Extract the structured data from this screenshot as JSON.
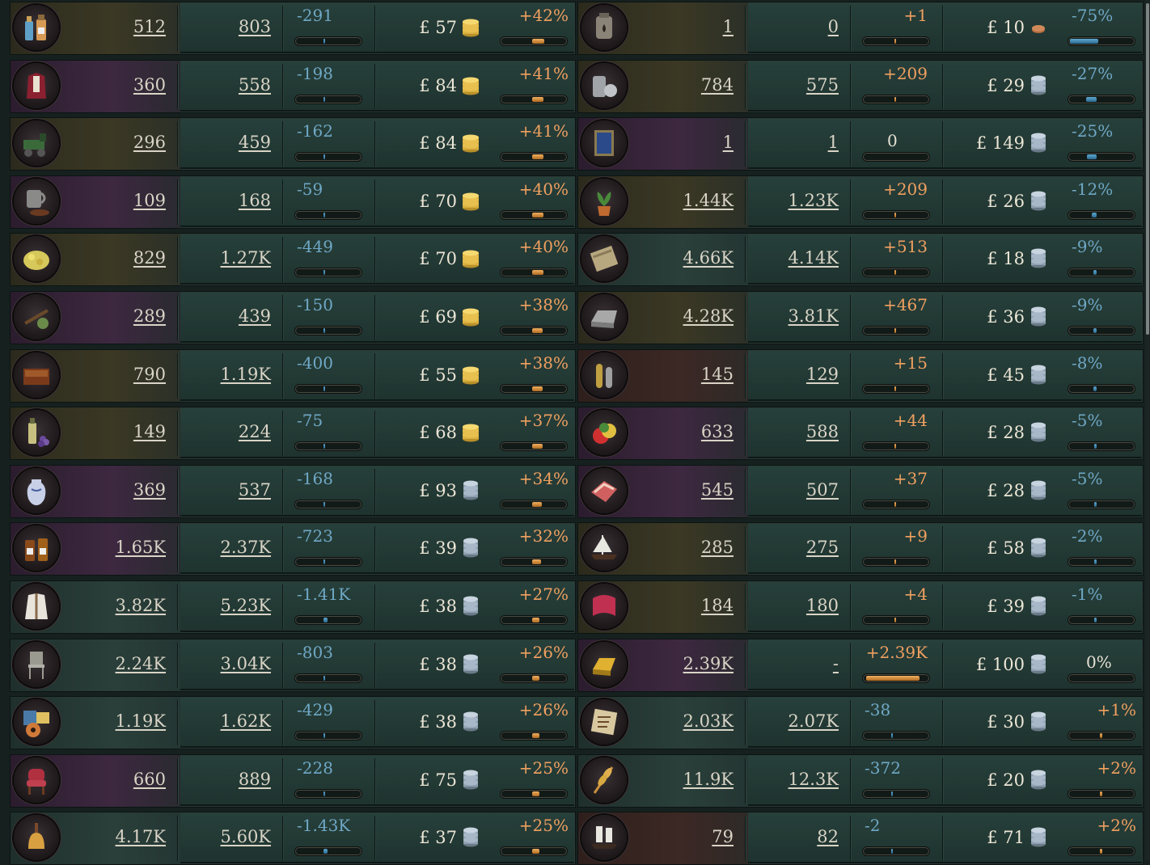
{
  "rows_left": [
    {
      "icon": "medicine-bottles-icon",
      "theme": "olive",
      "supply": "512",
      "demand": "803",
      "delta": "-291",
      "delta_sign": "neg",
      "delta_fill": 0.0,
      "price": "£ 57",
      "coin": "gold",
      "pct": "+42%",
      "pct_sign": "pos",
      "pct_fill": 0.42
    },
    {
      "icon": "luxury-clothes-icon",
      "theme": "purple",
      "supply": "360",
      "demand": "558",
      "delta": "-198",
      "delta_sign": "neg",
      "delta_fill": 0.0,
      "price": "£ 84",
      "coin": "gold",
      "pct": "+41%",
      "pct_sign": "pos",
      "pct_fill": 0.41
    },
    {
      "icon": "engine-icon",
      "theme": "olive",
      "supply": "296",
      "demand": "459",
      "delta": "-162",
      "delta_sign": "neg",
      "delta_fill": 0.0,
      "price": "£ 84",
      "coin": "gold",
      "pct": "+41%",
      "pct_sign": "pos",
      "pct_fill": 0.41
    },
    {
      "icon": "coffee-icon",
      "theme": "purple",
      "supply": "109",
      "demand": "168",
      "delta": "-59",
      "delta_sign": "neg",
      "delta_fill": 0.0,
      "price": "£ 70",
      "coin": "gold",
      "pct": "+40%",
      "pct_sign": "pos",
      "pct_fill": 0.4
    },
    {
      "icon": "gold-nuggets-icon",
      "theme": "olive",
      "supply": "829",
      "demand": "1.27K",
      "delta": "-449",
      "delta_sign": "neg",
      "delta_fill": 0.0,
      "price": "£ 70",
      "coin": "gold",
      "pct": "+40%",
      "pct_sign": "pos",
      "pct_fill": 0.4
    },
    {
      "icon": "opium-icon",
      "theme": "purple",
      "supply": "289",
      "demand": "439",
      "delta": "-150",
      "delta_sign": "neg",
      "delta_fill": 0.0,
      "price": "£ 69",
      "coin": "gold",
      "pct": "+38%",
      "pct_sign": "pos",
      "pct_fill": 0.38
    },
    {
      "icon": "tobacco-icon",
      "theme": "olive",
      "supply": "790",
      "demand": "1.19K",
      "delta": "-400",
      "delta_sign": "neg",
      "delta_fill": 0.0,
      "price": "£ 55",
      "coin": "gold",
      "pct": "+38%",
      "pct_sign": "pos",
      "pct_fill": 0.38
    },
    {
      "icon": "wine-icon",
      "theme": "olive",
      "supply": "149",
      "demand": "224",
      "delta": "-75",
      "delta_sign": "neg",
      "delta_fill": 0.0,
      "price": "£ 68",
      "coin": "gold",
      "pct": "+37%",
      "pct_sign": "pos",
      "pct_fill": 0.37
    },
    {
      "icon": "porcelain-icon",
      "theme": "purple",
      "supply": "369",
      "demand": "537",
      "delta": "-168",
      "delta_sign": "neg",
      "delta_fill": 0.0,
      "price": "£ 93",
      "coin": "silver",
      "pct": "+34%",
      "pct_sign": "pos",
      "pct_fill": 0.34
    },
    {
      "icon": "liquor-icon",
      "theme": "purple",
      "supply": "1.65K",
      "demand": "2.37K",
      "delta": "-723",
      "delta_sign": "neg",
      "delta_fill": 0.0,
      "price": "£ 39",
      "coin": "silver",
      "pct": "+32%",
      "pct_sign": "pos",
      "pct_fill": 0.32
    },
    {
      "icon": "clothes-icon",
      "theme": "teal",
      "supply": "3.82K",
      "demand": "5.23K",
      "delta": "-1.41K",
      "delta_sign": "neg",
      "delta_fill": 0.06,
      "price": "£ 38",
      "coin": "silver",
      "pct": "+27%",
      "pct_sign": "pos",
      "pct_fill": 0.27
    },
    {
      "icon": "furniture-icon",
      "theme": "teal",
      "supply": "2.24K",
      "demand": "3.04K",
      "delta": "-803",
      "delta_sign": "neg",
      "delta_fill": 0.03,
      "price": "£ 38",
      "coin": "silver",
      "pct": "+26%",
      "pct_sign": "pos",
      "pct_fill": 0.26
    },
    {
      "icon": "groceries-icon",
      "theme": "teal",
      "supply": "1.19K",
      "demand": "1.62K",
      "delta": "-429",
      "delta_sign": "neg",
      "delta_fill": 0.0,
      "price": "£ 38",
      "coin": "silver",
      "pct": "+26%",
      "pct_sign": "pos",
      "pct_fill": 0.26
    },
    {
      "icon": "luxury-furniture-icon",
      "theme": "purple",
      "supply": "660",
      "demand": "889",
      "delta": "-228",
      "delta_sign": "neg",
      "delta_fill": 0.0,
      "price": "£ 75",
      "coin": "silver",
      "pct": "+25%",
      "pct_sign": "pos",
      "pct_fill": 0.25
    },
    {
      "icon": "services-bell-icon",
      "theme": "teal",
      "supply": "4.17K",
      "demand": "5.60K",
      "delta": "-1.43K",
      "delta_sign": "neg",
      "delta_fill": 0.06,
      "price": "£ 37",
      "coin": "silver",
      "pct": "+25%",
      "pct_sign": "pos",
      "pct_fill": 0.25
    }
  ],
  "rows_right": [
    {
      "icon": "oil-icon",
      "theme": "olive",
      "supply": "1",
      "demand": "0",
      "delta": "+1",
      "delta_sign": "pos",
      "delta_fill": 0.0,
      "price": "£ 10",
      "coin": "copper",
      "pct": "-75%",
      "pct_sign": "neg",
      "pct_fill": 0.75
    },
    {
      "icon": "steel-icon",
      "theme": "olive",
      "supply": "784",
      "demand": "575",
      "delta": "+209",
      "delta_sign": "pos",
      "delta_fill": 0.02,
      "price": "£ 29",
      "coin": "silver",
      "pct": "-27%",
      "pct_sign": "neg",
      "pct_fill": 0.27
    },
    {
      "icon": "fine-art-icon",
      "theme": "purple",
      "supply": "1",
      "demand": "1",
      "delta": "0",
      "delta_sign": "zero",
      "delta_fill": 0.0,
      "price": "£ 149",
      "coin": "silver",
      "pct": "-25%",
      "pct_sign": "neg",
      "pct_fill": 0.25
    },
    {
      "icon": "fertilizer-icon",
      "theme": "olive",
      "supply": "1.44K",
      "demand": "1.23K",
      "delta": "+209",
      "delta_sign": "pos",
      "delta_fill": 0.02,
      "price": "£ 26",
      "coin": "silver",
      "pct": "-12%",
      "pct_sign": "neg",
      "pct_fill": 0.12
    },
    {
      "icon": "paper-icon",
      "theme": "teal",
      "supply": "4.66K",
      "demand": "4.14K",
      "delta": "+513",
      "delta_sign": "pos",
      "delta_fill": 0.03,
      "price": "£ 18",
      "coin": "silver",
      "pct": "-9%",
      "pct_sign": "neg",
      "pct_fill": 0.09
    },
    {
      "icon": "iron-ingot-icon",
      "theme": "olive",
      "supply": "4.28K",
      "demand": "3.81K",
      "delta": "+467",
      "delta_sign": "pos",
      "delta_fill": 0.03,
      "price": "£ 36",
      "coin": "silver",
      "pct": "-9%",
      "pct_sign": "neg",
      "pct_fill": 0.09
    },
    {
      "icon": "ammunition-icon",
      "theme": "rust",
      "supply": "145",
      "demand": "129",
      "delta": "+15",
      "delta_sign": "pos",
      "delta_fill": 0.0,
      "price": "£ 45",
      "coin": "silver",
      "pct": "-8%",
      "pct_sign": "neg",
      "pct_fill": 0.08
    },
    {
      "icon": "fruit-icon",
      "theme": "purple",
      "supply": "633",
      "demand": "588",
      "delta": "+44",
      "delta_sign": "pos",
      "delta_fill": 0.0,
      "price": "£ 28",
      "coin": "silver",
      "pct": "-5%",
      "pct_sign": "neg",
      "pct_fill": 0.05
    },
    {
      "icon": "meat-icon",
      "theme": "purple",
      "supply": "545",
      "demand": "507",
      "delta": "+37",
      "delta_sign": "pos",
      "delta_fill": 0.0,
      "price": "£ 28",
      "coin": "silver",
      "pct": "-5%",
      "pct_sign": "neg",
      "pct_fill": 0.05
    },
    {
      "icon": "clippers-icon",
      "theme": "olive",
      "supply": "285",
      "demand": "275",
      "delta": "+9",
      "delta_sign": "pos",
      "delta_fill": 0.0,
      "price": "£ 58",
      "coin": "silver",
      "pct": "-2%",
      "pct_sign": "neg",
      "pct_fill": 0.02
    },
    {
      "icon": "silk-icon",
      "theme": "olive",
      "supply": "184",
      "demand": "180",
      "delta": "+4",
      "delta_sign": "pos",
      "delta_fill": 0.0,
      "price": "£ 39",
      "coin": "silver",
      "pct": "-1%",
      "pct_sign": "neg",
      "pct_fill": 0.01
    },
    {
      "icon": "gold-bars-icon",
      "theme": "purple",
      "supply": "2.39K",
      "demand": "-",
      "delta": "+2.39K",
      "delta_sign": "pos",
      "delta_fill": 0.85,
      "price": "£ 100",
      "coin": "silver",
      "pct": "0%",
      "pct_sign": "zero",
      "pct_fill": 0.0
    },
    {
      "icon": "tea-icon",
      "theme": "teal",
      "supply": "2.03K",
      "demand": "2.07K",
      "delta": "-38",
      "delta_sign": "neg",
      "delta_fill": 0.0,
      "price": "£ 30",
      "coin": "silver",
      "pct": "+1%",
      "pct_sign": "pos",
      "pct_fill": 0.01
    },
    {
      "icon": "grain-icon",
      "theme": "teal",
      "supply": "11.9K",
      "demand": "12.3K",
      "delta": "-372",
      "delta_sign": "neg",
      "delta_fill": 0.0,
      "price": "£ 20",
      "coin": "silver",
      "pct": "+2%",
      "pct_sign": "pos",
      "pct_fill": 0.02
    },
    {
      "icon": "manowar-icon",
      "theme": "rust",
      "supply": "79",
      "demand": "82",
      "delta": "-2",
      "delta_sign": "neg",
      "delta_fill": 0.0,
      "price": "£ 71",
      "coin": "silver",
      "pct": "+2%",
      "pct_sign": "pos",
      "pct_fill": 0.02
    }
  ]
}
